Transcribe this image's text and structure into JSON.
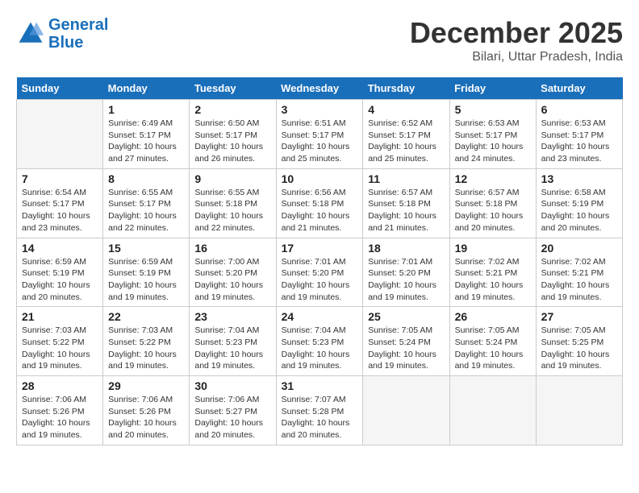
{
  "header": {
    "logo_line1": "General",
    "logo_line2": "Blue",
    "month": "December 2025",
    "location": "Bilari, Uttar Pradesh, India"
  },
  "days_of_week": [
    "Sunday",
    "Monday",
    "Tuesday",
    "Wednesday",
    "Thursday",
    "Friday",
    "Saturday"
  ],
  "weeks": [
    [
      {
        "day": "",
        "info": ""
      },
      {
        "day": "1",
        "info": "Sunrise: 6:49 AM\nSunset: 5:17 PM\nDaylight: 10 hours\nand 27 minutes."
      },
      {
        "day": "2",
        "info": "Sunrise: 6:50 AM\nSunset: 5:17 PM\nDaylight: 10 hours\nand 26 minutes."
      },
      {
        "day": "3",
        "info": "Sunrise: 6:51 AM\nSunset: 5:17 PM\nDaylight: 10 hours\nand 25 minutes."
      },
      {
        "day": "4",
        "info": "Sunrise: 6:52 AM\nSunset: 5:17 PM\nDaylight: 10 hours\nand 25 minutes."
      },
      {
        "day": "5",
        "info": "Sunrise: 6:53 AM\nSunset: 5:17 PM\nDaylight: 10 hours\nand 24 minutes."
      },
      {
        "day": "6",
        "info": "Sunrise: 6:53 AM\nSunset: 5:17 PM\nDaylight: 10 hours\nand 23 minutes."
      }
    ],
    [
      {
        "day": "7",
        "info": "Sunrise: 6:54 AM\nSunset: 5:17 PM\nDaylight: 10 hours\nand 23 minutes."
      },
      {
        "day": "8",
        "info": "Sunrise: 6:55 AM\nSunset: 5:17 PM\nDaylight: 10 hours\nand 22 minutes."
      },
      {
        "day": "9",
        "info": "Sunrise: 6:55 AM\nSunset: 5:18 PM\nDaylight: 10 hours\nand 22 minutes."
      },
      {
        "day": "10",
        "info": "Sunrise: 6:56 AM\nSunset: 5:18 PM\nDaylight: 10 hours\nand 21 minutes."
      },
      {
        "day": "11",
        "info": "Sunrise: 6:57 AM\nSunset: 5:18 PM\nDaylight: 10 hours\nand 21 minutes."
      },
      {
        "day": "12",
        "info": "Sunrise: 6:57 AM\nSunset: 5:18 PM\nDaylight: 10 hours\nand 20 minutes."
      },
      {
        "day": "13",
        "info": "Sunrise: 6:58 AM\nSunset: 5:19 PM\nDaylight: 10 hours\nand 20 minutes."
      }
    ],
    [
      {
        "day": "14",
        "info": "Sunrise: 6:59 AM\nSunset: 5:19 PM\nDaylight: 10 hours\nand 20 minutes."
      },
      {
        "day": "15",
        "info": "Sunrise: 6:59 AM\nSunset: 5:19 PM\nDaylight: 10 hours\nand 19 minutes."
      },
      {
        "day": "16",
        "info": "Sunrise: 7:00 AM\nSunset: 5:20 PM\nDaylight: 10 hours\nand 19 minutes."
      },
      {
        "day": "17",
        "info": "Sunrise: 7:01 AM\nSunset: 5:20 PM\nDaylight: 10 hours\nand 19 minutes."
      },
      {
        "day": "18",
        "info": "Sunrise: 7:01 AM\nSunset: 5:20 PM\nDaylight: 10 hours\nand 19 minutes."
      },
      {
        "day": "19",
        "info": "Sunrise: 7:02 AM\nSunset: 5:21 PM\nDaylight: 10 hours\nand 19 minutes."
      },
      {
        "day": "20",
        "info": "Sunrise: 7:02 AM\nSunset: 5:21 PM\nDaylight: 10 hours\nand 19 minutes."
      }
    ],
    [
      {
        "day": "21",
        "info": "Sunrise: 7:03 AM\nSunset: 5:22 PM\nDaylight: 10 hours\nand 19 minutes."
      },
      {
        "day": "22",
        "info": "Sunrise: 7:03 AM\nSunset: 5:22 PM\nDaylight: 10 hours\nand 19 minutes."
      },
      {
        "day": "23",
        "info": "Sunrise: 7:04 AM\nSunset: 5:23 PM\nDaylight: 10 hours\nand 19 minutes."
      },
      {
        "day": "24",
        "info": "Sunrise: 7:04 AM\nSunset: 5:23 PM\nDaylight: 10 hours\nand 19 minutes."
      },
      {
        "day": "25",
        "info": "Sunrise: 7:05 AM\nSunset: 5:24 PM\nDaylight: 10 hours\nand 19 minutes."
      },
      {
        "day": "26",
        "info": "Sunrise: 7:05 AM\nSunset: 5:24 PM\nDaylight: 10 hours\nand 19 minutes."
      },
      {
        "day": "27",
        "info": "Sunrise: 7:05 AM\nSunset: 5:25 PM\nDaylight: 10 hours\nand 19 minutes."
      }
    ],
    [
      {
        "day": "28",
        "info": "Sunrise: 7:06 AM\nSunset: 5:26 PM\nDaylight: 10 hours\nand 19 minutes."
      },
      {
        "day": "29",
        "info": "Sunrise: 7:06 AM\nSunset: 5:26 PM\nDaylight: 10 hours\nand 20 minutes."
      },
      {
        "day": "30",
        "info": "Sunrise: 7:06 AM\nSunset: 5:27 PM\nDaylight: 10 hours\nand 20 minutes."
      },
      {
        "day": "31",
        "info": "Sunrise: 7:07 AM\nSunset: 5:28 PM\nDaylight: 10 hours\nand 20 minutes."
      },
      {
        "day": "",
        "info": ""
      },
      {
        "day": "",
        "info": ""
      },
      {
        "day": "",
        "info": ""
      }
    ]
  ]
}
